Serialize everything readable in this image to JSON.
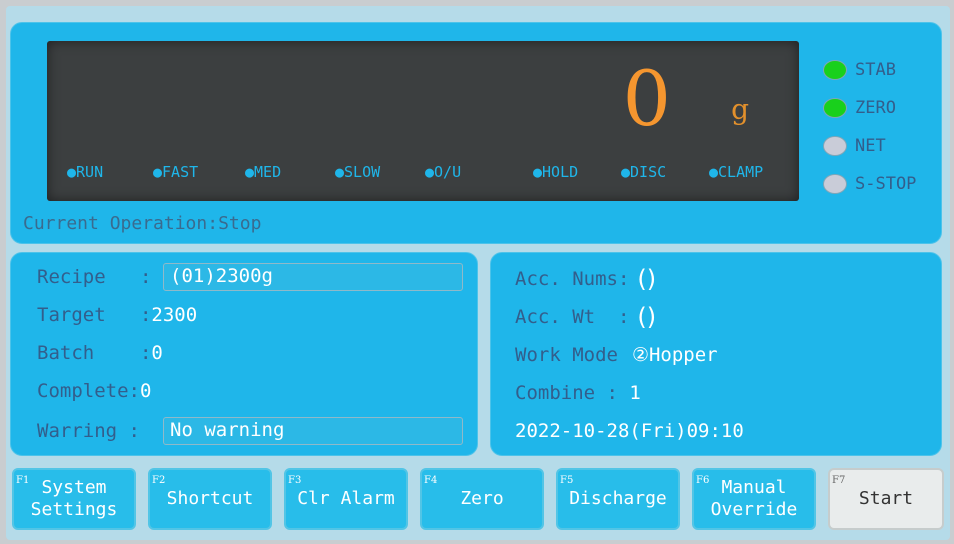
{
  "display": {
    "weight": "0",
    "unit": "g",
    "status_flags": [
      "●RUN",
      "●FAST",
      "●MED",
      "●SLOW",
      "●O/U",
      "●HOLD",
      "●DISC",
      "●CLAMP"
    ],
    "current_operation_label": "Current Operation:",
    "current_operation_value": "Stop"
  },
  "indicators": [
    {
      "label": "STAB",
      "state": "on",
      "color": "#19d01c"
    },
    {
      "label": "ZERO",
      "state": "on",
      "color": "#19d01c"
    },
    {
      "label": "NET",
      "state": "off",
      "color": "#c9ccd8"
    },
    {
      "label": "S-STOP",
      "state": "off",
      "color": "#c9ccd8"
    }
  ],
  "info": {
    "recipe_label": "Recipe   :",
    "recipe_value": "(01)2300g",
    "target_label": "Target   :",
    "target_value": "2300",
    "batch_label": "Batch    :",
    "batch_value": "0",
    "complete_label": "Complete:",
    "complete_value": "0",
    "warring_label": "Warring :",
    "warring_value": "No warning"
  },
  "stats": {
    "acc_nums_label": "Acc. Nums:",
    "acc_nums_value": "()",
    "acc_wt_label": "Acc. Wt  :",
    "acc_wt_value": "()",
    "work_mode_label": "Work Mode",
    "work_mode_value": "②Hopper",
    "combine_label": "Combine : ",
    "combine_value": "1",
    "datetime": "2022-10-28(Fri)09:10"
  },
  "fkeys": [
    {
      "num": "F1",
      "label": "System\nSettings"
    },
    {
      "num": "F2",
      "label": "Shortcut"
    },
    {
      "num": "F3",
      "label": "Clr Alarm"
    },
    {
      "num": "F4",
      "label": "Zero"
    },
    {
      "num": "F5",
      "label": "Discharge"
    },
    {
      "num": "F6",
      "label": "Manual\nOverride"
    },
    {
      "num": "F7",
      "label": "Start"
    }
  ]
}
